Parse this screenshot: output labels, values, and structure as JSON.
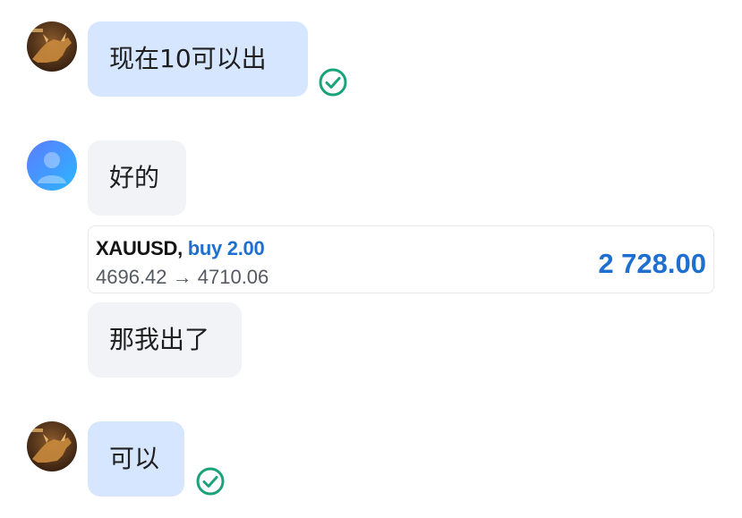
{
  "colors": {
    "outgoing_bubble": "#d7e6ff",
    "incoming_bubble": "#f1f3f7",
    "read_check": "#1aa37a",
    "trade_accent": "#1f6fd1"
  },
  "messages": [
    {
      "sender": "me",
      "avatar": "bull-avatar-icon",
      "text": "现在10可以出",
      "status": "read-check-icon"
    },
    {
      "sender": "other",
      "avatar": "default-user-avatar-icon",
      "text": "好的"
    },
    {
      "sender": "other",
      "type": "trade_card",
      "symbol": "XAUUSD",
      "separator": ",",
      "side": "buy 2.00",
      "prices": "4696.42 → 4710.06",
      "profit": "2 728.00"
    },
    {
      "sender": "other",
      "text": "那我出了"
    },
    {
      "sender": "me",
      "avatar": "bull-avatar-icon",
      "text": "可以",
      "status": "read-check-icon"
    }
  ]
}
